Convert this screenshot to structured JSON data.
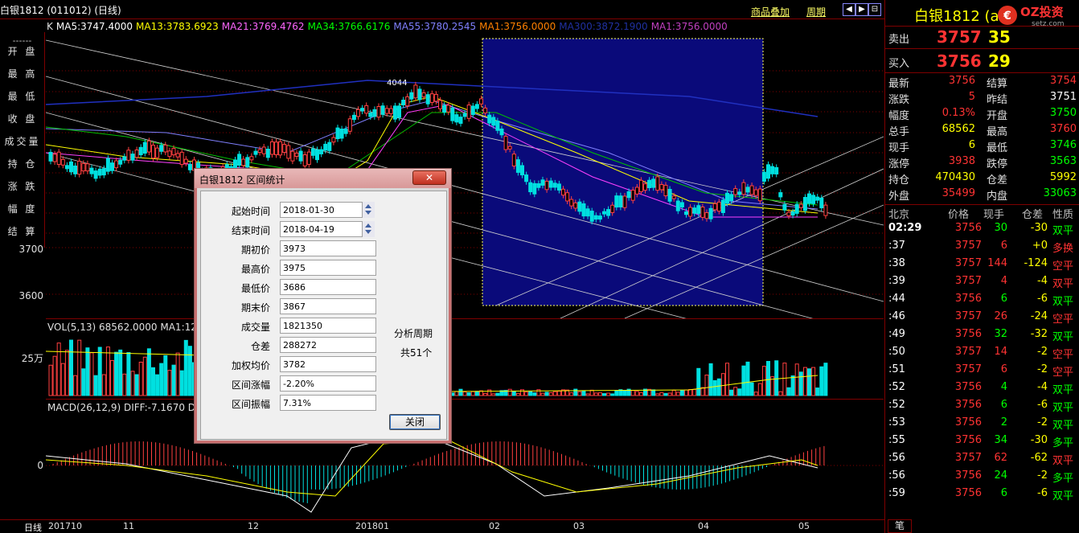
{
  "header": {
    "title": "白银1812 (011012) (日线)",
    "overlay_link": "商品叠加",
    "period_link": "周期",
    "nav_buttons": [
      "◀",
      "▶",
      "⊟",
      "⊞"
    ]
  },
  "ma_row": [
    {
      "label": "K",
      "color": "#e0e0e0"
    },
    {
      "label": "MA5:3747.4000",
      "color": "#ffffff"
    },
    {
      "label": "MA13:3783.6923",
      "color": "#ffff00"
    },
    {
      "label": "MA21:3769.4762",
      "color": "#ff66ff"
    },
    {
      "label": "MA34:3766.6176",
      "color": "#00ff00"
    },
    {
      "label": "MA55:3780.2545",
      "color": "#8080ff"
    },
    {
      "label": "MA1:3756.0000",
      "color": "#ff8000"
    },
    {
      "label": "MA300:3872.1900",
      "color": "#2030a0"
    },
    {
      "label": "MA1:3756.0000",
      "color": "#c040c0"
    }
  ],
  "left_panel": {
    "dash": "------",
    "items": [
      "开 盘",
      "最 高",
      "最 低",
      "收 盘",
      "成交量",
      "持 仓",
      "涨 跌",
      "幅 度",
      "结 算"
    ]
  },
  "axis": {
    "price_3700": "3700",
    "price_3600": "3600",
    "vol_25w": "25万",
    "macd_zero": "0"
  },
  "vol_label": "VOL(5,13) 68562.0000 MA1:126",
  "macd_label": "MACD(26,12,9) DIFF:-7.1670 DE",
  "peak_label": "4044",
  "dates": [
    "日线",
    "201710",
    "11",
    "12",
    "201801",
    "02",
    "03",
    "04",
    "05"
  ],
  "right_panel": {
    "title": "白银1812 (a",
    "logo": "OZ投资",
    "logo_sub": "setz.com",
    "sell_label": "卖出",
    "sell_price": "3757",
    "sell_vol": "35",
    "buy_label": "买入",
    "buy_price": "3756",
    "buy_vol": "29",
    "stats": [
      {
        "l1": "最新",
        "v1": "3756",
        "c1": "#ff3333",
        "l2": "结算",
        "v2": "3754",
        "c2": "#ff3333"
      },
      {
        "l1": "涨跌",
        "v1": "5",
        "c1": "#ff3333",
        "l2": "昨结",
        "v2": "3751",
        "c2": "#ffffff"
      },
      {
        "l1": "幅度",
        "v1": "0.13%",
        "c1": "#ff3333",
        "l2": "开盘",
        "v2": "3750",
        "c2": "#00ff00"
      },
      {
        "l1": "总手",
        "v1": "68562",
        "c1": "#ffff00",
        "l2": "最高",
        "v2": "3760",
        "c2": "#ff3333"
      },
      {
        "l1": "现手",
        "v1": "6",
        "c1": "#ffff00",
        "l2": "最低",
        "v2": "3746",
        "c2": "#00ff00"
      },
      {
        "l1": "涨停",
        "v1": "3938",
        "c1": "#ff3333",
        "l2": "跌停",
        "v2": "3563",
        "c2": "#00ff00"
      },
      {
        "l1": "持仓",
        "v1": "470430",
        "c1": "#ffff00",
        "l2": "仓差",
        "v2": "5992",
        "c2": "#ffff00"
      },
      {
        "l1": "外盘",
        "v1": "35499",
        "c1": "#ff3333",
        "l2": "内盘",
        "v2": "33063",
        "c2": "#00ff00"
      }
    ],
    "tick_header": [
      "北京",
      "价格",
      "现手",
      "仓差",
      "性质"
    ],
    "ticks": [
      {
        "t": "02:29",
        "p": "3756",
        "pc": "#ff3333",
        "v": "30",
        "vc": "#00ff00",
        "d": "-30",
        "dc": "#ffff00",
        "n": "双平",
        "nc": "#00ff00"
      },
      {
        "t": ":37",
        "p": "3757",
        "pc": "#ff3333",
        "v": "6",
        "vc": "#ff3333",
        "d": "+0",
        "dc": "#ffff00",
        "n": "多换",
        "nc": "#ff3333"
      },
      {
        "t": ":38",
        "p": "3757",
        "pc": "#ff3333",
        "v": "144",
        "vc": "#ff3333",
        "d": "-124",
        "dc": "#ffff00",
        "n": "空平",
        "nc": "#ff3333"
      },
      {
        "t": ":39",
        "p": "3757",
        "pc": "#ff3333",
        "v": "4",
        "vc": "#ff3333",
        "d": "-4",
        "dc": "#ffff00",
        "n": "双平",
        "nc": "#ff3333"
      },
      {
        "t": ":44",
        "p": "3756",
        "pc": "#ff3333",
        "v": "6",
        "vc": "#00ff00",
        "d": "-6",
        "dc": "#ffff00",
        "n": "双平",
        "nc": "#00ff00"
      },
      {
        "t": ":46",
        "p": "3757",
        "pc": "#ff3333",
        "v": "26",
        "vc": "#ff3333",
        "d": "-24",
        "dc": "#ffff00",
        "n": "空平",
        "nc": "#ff3333"
      },
      {
        "t": ":49",
        "p": "3756",
        "pc": "#ff3333",
        "v": "32",
        "vc": "#00ff00",
        "d": "-32",
        "dc": "#ffff00",
        "n": "双平",
        "nc": "#00ff00"
      },
      {
        "t": ":50",
        "p": "3757",
        "pc": "#ff3333",
        "v": "14",
        "vc": "#ff3333",
        "d": "-2",
        "dc": "#ffff00",
        "n": "空平",
        "nc": "#ff3333"
      },
      {
        "t": ":51",
        "p": "3757",
        "pc": "#ff3333",
        "v": "6",
        "vc": "#ff3333",
        "d": "-2",
        "dc": "#ffff00",
        "n": "空平",
        "nc": "#ff3333"
      },
      {
        "t": ":52",
        "p": "3756",
        "pc": "#ff3333",
        "v": "4",
        "vc": "#00ff00",
        "d": "-4",
        "dc": "#ffff00",
        "n": "双平",
        "nc": "#00ff00"
      },
      {
        "t": ":52",
        "p": "3756",
        "pc": "#ff3333",
        "v": "6",
        "vc": "#00ff00",
        "d": "-6",
        "dc": "#ffff00",
        "n": "双平",
        "nc": "#00ff00"
      },
      {
        "t": ":53",
        "p": "3756",
        "pc": "#ff3333",
        "v": "2",
        "vc": "#00ff00",
        "d": "-2",
        "dc": "#ffff00",
        "n": "双平",
        "nc": "#00ff00"
      },
      {
        "t": ":55",
        "p": "3756",
        "pc": "#ff3333",
        "v": "34",
        "vc": "#00ff00",
        "d": "-30",
        "dc": "#ffff00",
        "n": "多平",
        "nc": "#00ff00"
      },
      {
        "t": ":56",
        "p": "3757",
        "pc": "#ff3333",
        "v": "62",
        "vc": "#ff3333",
        "d": "-62",
        "dc": "#ffff00",
        "n": "双平",
        "nc": "#ff3333"
      },
      {
        "t": ":56",
        "p": "3756",
        "pc": "#ff3333",
        "v": "24",
        "vc": "#00ff00",
        "d": "-2",
        "dc": "#ffff00",
        "n": "多平",
        "nc": "#00ff00"
      },
      {
        "t": ":59",
        "p": "3756",
        "pc": "#ff3333",
        "v": "6",
        "vc": "#00ff00",
        "d": "-6",
        "dc": "#ffff00",
        "n": "双平",
        "nc": "#00ff00"
      }
    ],
    "bottom_tab": "笔"
  },
  "dialog": {
    "title": "白银1812 区间统计",
    "close": "✕",
    "fields": [
      {
        "label": "起始时间",
        "value": "2018-01-30",
        "spin": true
      },
      {
        "label": "结束时间",
        "value": "2018-04-19",
        "spin": true
      },
      {
        "label": "期初价",
        "value": "3973"
      },
      {
        "label": "最高价",
        "value": "3975"
      },
      {
        "label": "最低价",
        "value": "3686"
      },
      {
        "label": "期末价",
        "value": "3867"
      },
      {
        "label": "成交量",
        "value": "1821350"
      },
      {
        "label": "仓差",
        "value": "288272"
      },
      {
        "label": "加权均价",
        "value": "3782"
      },
      {
        "label": "区间涨幅",
        "value": "-2.20%"
      },
      {
        "label": "区间振幅",
        "value": "7.31%"
      }
    ],
    "note1": "分析周期",
    "note2": "共51个",
    "ok_button": "关闭"
  }
}
